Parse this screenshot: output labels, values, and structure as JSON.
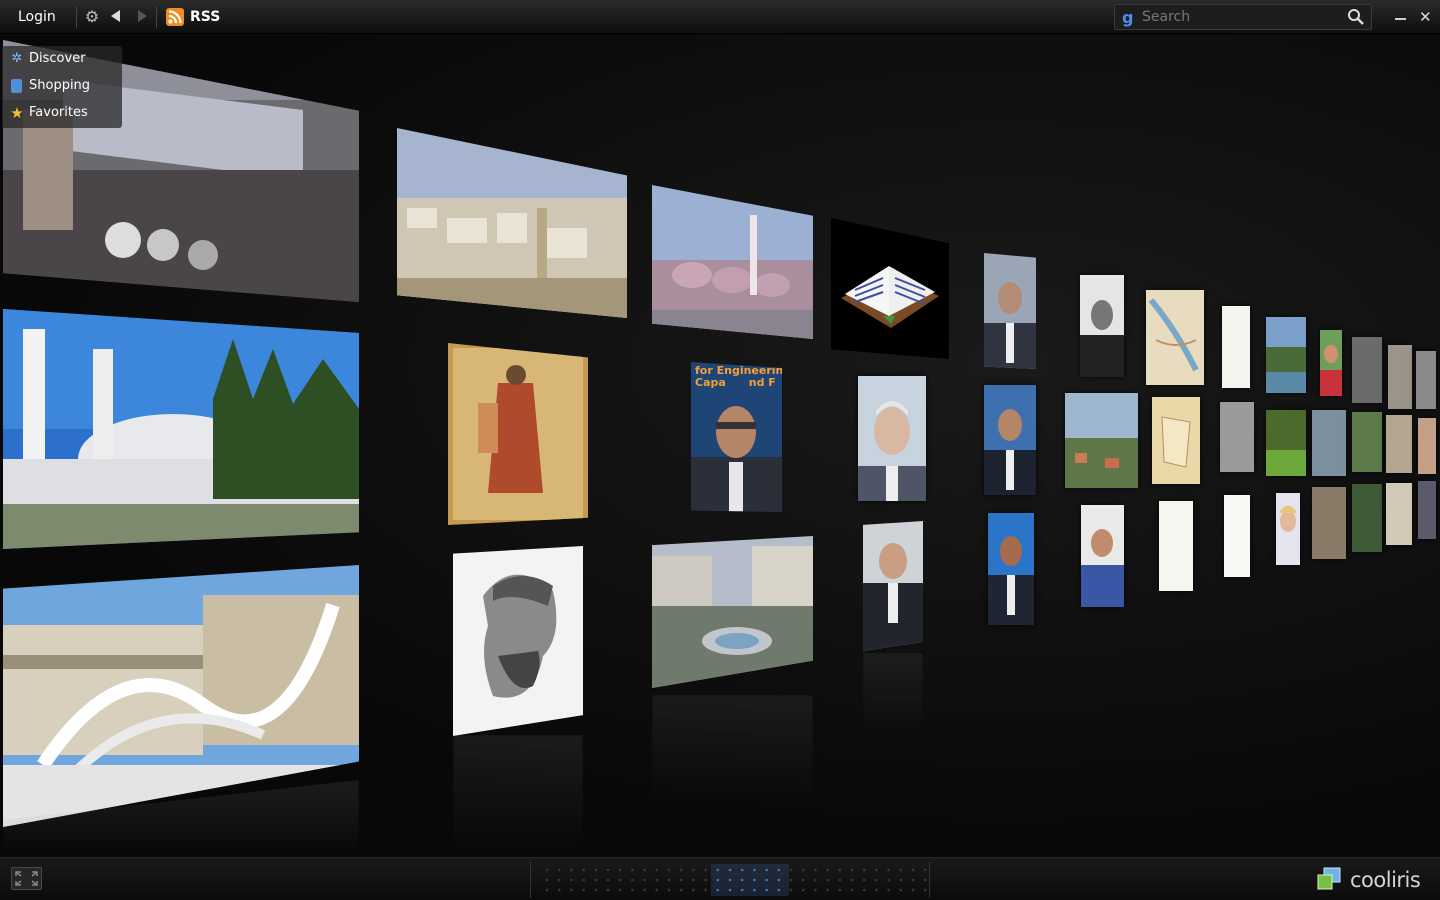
{
  "topbar": {
    "login_label": "Login",
    "rss_label": "RSS",
    "search_placeholder": "Search"
  },
  "side_menu": {
    "items": [
      {
        "label": "Discover",
        "icon": "discover-icon"
      },
      {
        "label": "Shopping",
        "icon": "shopping-bag-icon"
      },
      {
        "label": "Favorites",
        "icon": "star-icon"
      }
    ]
  },
  "wall": {
    "tiles": [
      {
        "name": "market-street-photo"
      },
      {
        "name": "mosque-domes-photo"
      },
      {
        "name": "city-statue-photo"
      },
      {
        "name": "hillside-town-photo"
      },
      {
        "name": "manuscript-figure-image"
      },
      {
        "name": "scholar-sketch-image"
      },
      {
        "name": "mosque-minaret-photo"
      },
      {
        "name": "speaker-portrait-photo",
        "caption": "for Engineering\nCapa      nd F"
      },
      {
        "name": "city-square-photo"
      },
      {
        "name": "open-book-icon-image"
      },
      {
        "name": "man-portrait-photo"
      },
      {
        "name": "suited-man-portrait-photo"
      }
    ]
  },
  "bottombar": {
    "brand": "cooliris"
  },
  "colors": {
    "background": "#0a0a0a",
    "accent": "#4a8df5",
    "rss": "#f28c1e"
  }
}
